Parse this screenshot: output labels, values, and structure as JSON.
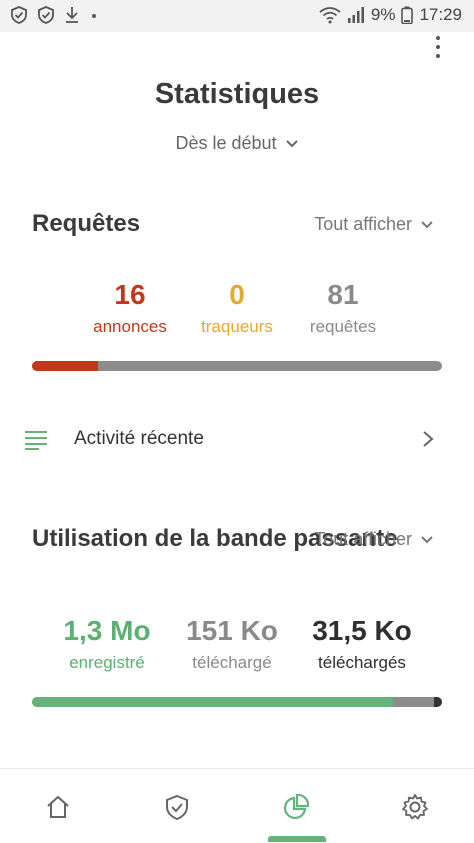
{
  "status_bar": {
    "battery": "9%",
    "time": "17:29"
  },
  "header": {
    "title": "Statistiques",
    "period": "Dès le début"
  },
  "requests": {
    "title": "Requêtes",
    "show_all": "Tout afficher",
    "stats": [
      {
        "value": "16",
        "label": "annonces",
        "color": "#c0391b"
      },
      {
        "value": "0",
        "label": "traqueurs",
        "color": "#e6a92a"
      },
      {
        "value": "81",
        "label": "requêtes",
        "color": "#8a8a8a"
      }
    ],
    "progress": {
      "ads_fraction": 0.16,
      "trackers_fraction": 0.0
    }
  },
  "activity": {
    "label": "Activité récente"
  },
  "bandwidth": {
    "title": "Utilisation de la bande passante",
    "show_all": "Tout afficher",
    "stats": [
      {
        "value": "1,3 Mo",
        "label": "enregistré",
        "color": "#5cb070"
      },
      {
        "value": "151 Ko",
        "label": "téléchargé",
        "color": "#8a8a8a"
      },
      {
        "value": "31,5 Ko",
        "label": "téléchargés",
        "color": "#2f2f2f"
      }
    ],
    "progress": {
      "saved_fraction": 0.88,
      "download_fraction": 0.1,
      "upload_fraction": 0.02
    }
  },
  "bottom_nav": [
    {
      "name": "home",
      "icon": "home-icon",
      "active": false
    },
    {
      "name": "protection",
      "icon": "shield-check-icon",
      "active": false
    },
    {
      "name": "statistics",
      "icon": "pie-chart-icon",
      "active": true
    },
    {
      "name": "settings",
      "icon": "gear-icon",
      "active": false
    }
  ],
  "colors": {
    "accent": "#67b27a",
    "ads": "#c0391b",
    "trackers": "#e6a92a",
    "bar_bg": "#8c8c8c"
  }
}
